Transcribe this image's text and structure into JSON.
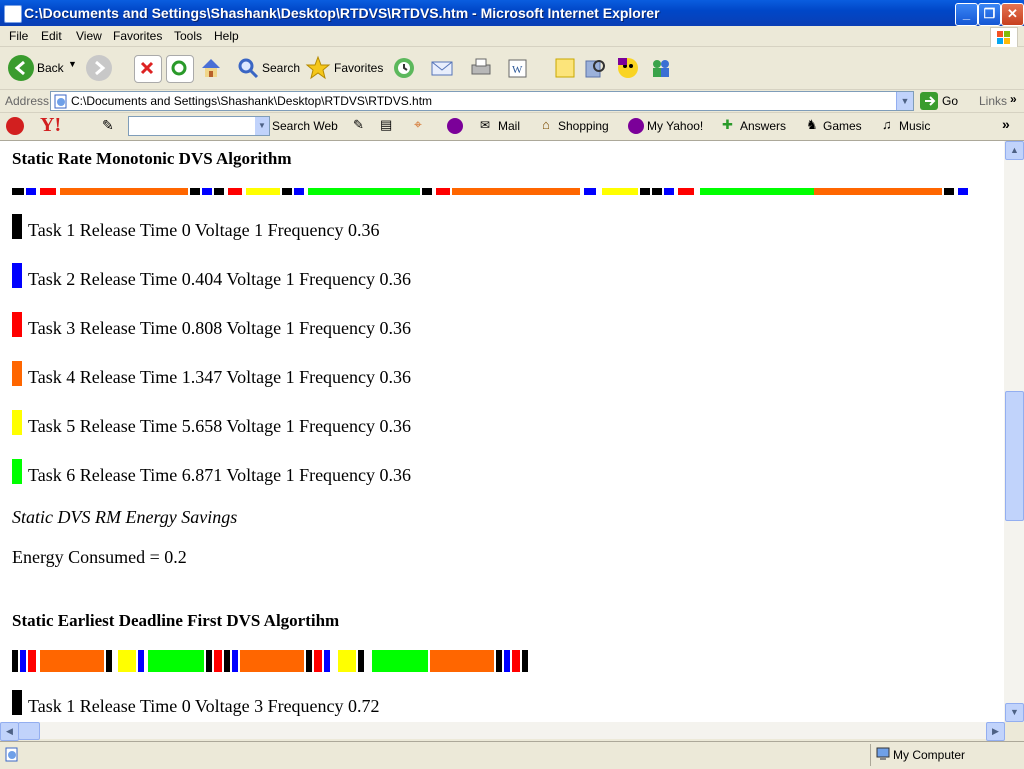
{
  "window": {
    "title": "C:\\Documents and Settings\\Shashank\\Desktop\\RTDVS\\RTDVS.htm - Microsoft Internet Explorer"
  },
  "menu": [
    "File",
    "Edit",
    "View",
    "Favorites",
    "Tools",
    "Help"
  ],
  "toolbar": {
    "back": "Back",
    "search": "Search",
    "favorites": "Favorites"
  },
  "address": {
    "label": "Address",
    "url": "C:\\Documents and Settings\\Shashank\\Desktop\\RTDVS\\RTDVS.htm",
    "go": "Go",
    "links": "Links"
  },
  "yahoo_toolbar": {
    "search_web": "Search Web",
    "mail": "Mail",
    "shopping": "Shopping",
    "my_yahoo": "My Yahoo!",
    "answers": "Answers",
    "games": "Games",
    "music": "Music"
  },
  "colors": {
    "task1": "#000000",
    "task2": "#0000ff",
    "task3": "#ff0000",
    "task4": "#ff6600",
    "task5": "#ffff00",
    "task6": "#00ff00"
  },
  "section1": {
    "title": "Static Rate Monotonic DVS Algorithm",
    "tasks": [
      {
        "text": "Task 1 Release Time 0 Voltage 1 Frequency 0.36",
        "color": "#000000"
      },
      {
        "text": "Task 2 Release Time 0.404 Voltage 1 Frequency 0.36",
        "color": "#0000ff"
      },
      {
        "text": "Task 3 Release Time 0.808 Voltage 1 Frequency 0.36",
        "color": "#ff0000"
      },
      {
        "text": "Task 4 Release Time 1.347 Voltage 1 Frequency 0.36",
        "color": "#ff6600"
      },
      {
        "text": "Task 5 Release Time 5.658 Voltage 1 Frequency 0.36",
        "color": "#ffff00"
      },
      {
        "text": "Task 6 Release Time 6.871 Voltage 1 Frequency 0.36",
        "color": "#00ff00"
      }
    ],
    "savings_label": "Static DVS RM Energy Savings",
    "energy": "Energy Consumed = 0.2"
  },
  "section2": {
    "title": "Static Earliest Deadline First DVS Algortihm",
    "tasks": [
      {
        "text": "Task 1 Release Time 0 Voltage 3 Frequency 0.72",
        "color": "#000000"
      }
    ]
  },
  "status": {
    "zone": "My Computer"
  }
}
